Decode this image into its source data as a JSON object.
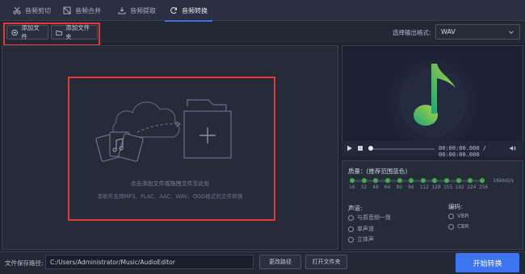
{
  "tabs": [
    {
      "label": "音频剪切",
      "icon": "scissors-icon"
    },
    {
      "label": "音频合并",
      "icon": "merge-icon"
    },
    {
      "label": "音频提取",
      "icon": "extract-icon"
    },
    {
      "label": "音频转换",
      "icon": "convert-icon",
      "active": true
    }
  ],
  "toolbar": {
    "add_file_label": "添加文件",
    "add_folder_label": "添加文件夹",
    "output_format_label": "选择输出格式:",
    "output_format_value": "WAV"
  },
  "drop_zone": {
    "hint": "点击添加文件或拖拽文件至此处",
    "supported": "本软件支持MP3、FLAC、AAC、WAV、OGG格式的文件转换"
  },
  "player": {
    "time": "00:00:00.000 / 00:00:00.000",
    "progress_fraction": 0
  },
  "settings": {
    "quality_label": "质量：(推荐范围蓝色)",
    "quality_ticks": [
      "16",
      "32",
      "48",
      "64",
      "80",
      "96",
      "112",
      "128",
      "155",
      "192",
      "224",
      "256"
    ],
    "quality_unit": "16kbit/s",
    "selected_quality": "16",
    "channel_label": "声道:",
    "channel_options": [
      "与原音频一致",
      "单声道",
      "立体声"
    ],
    "encoding_label": "编码:",
    "encoding_options": [
      "VBR",
      "CBR"
    ]
  },
  "bottom": {
    "save_path_label": "文件保存路径:",
    "save_path_value": "C:/Users/Administrator/Music/AudioEditor",
    "change_path_label": "更改路径",
    "open_folder_label": "打开文件夹",
    "start_label": "开始转换"
  },
  "colors": {
    "accent": "#3b75f0",
    "highlight_box": "#e53935",
    "quality_green": "#3fae4a"
  }
}
